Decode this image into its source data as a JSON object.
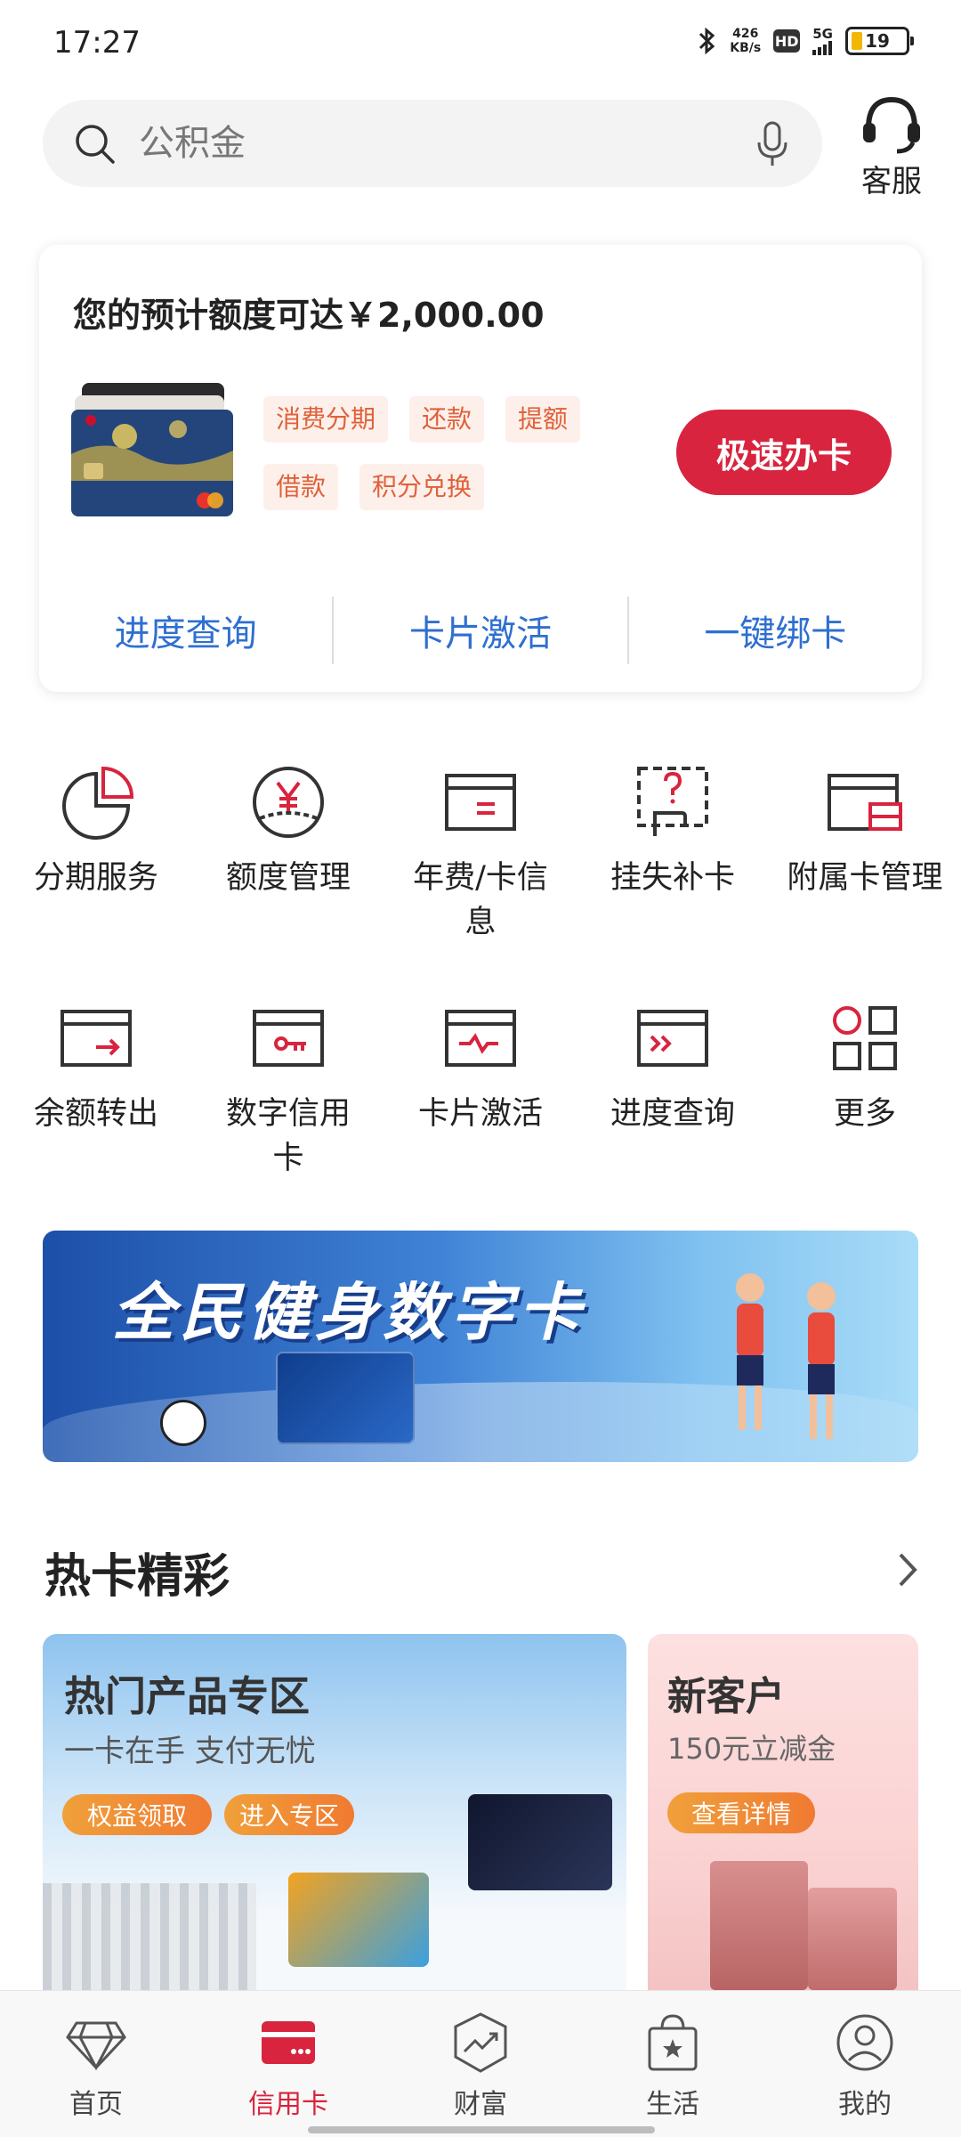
{
  "status": {
    "time": "17:27",
    "net_speed_value": "426",
    "net_speed_unit": "KB/s",
    "hd": "HD",
    "network": "5G",
    "battery": "19"
  },
  "search": {
    "placeholder": "公积金"
  },
  "customer_service": {
    "label": "客服"
  },
  "card_panel": {
    "title": "您的预计额度可达￥2,000.00",
    "tags": [
      "消费分期",
      "还款",
      "提额",
      "借款",
      "积分兑换"
    ],
    "apply_button": "极速办卡",
    "links": [
      "进度查询",
      "卡片激活",
      "一键绑卡"
    ]
  },
  "services": {
    "row1": [
      "分期服务",
      "额度管理",
      "年费/卡信息",
      "挂失补卡",
      "附属卡管理"
    ],
    "row2": [
      "余额转出",
      "数字信用卡",
      "卡片激活",
      "进度查询",
      "更多"
    ]
  },
  "banner": {
    "title": "全民健身数字卡"
  },
  "hot_section": {
    "title": "热卡精彩"
  },
  "promo_main": {
    "title": "热门产品专区",
    "subtitle": "一卡在手 支付无忧",
    "btn1": "权益领取",
    "btn2": "进入专区"
  },
  "promo_new": {
    "title": "新客户",
    "subtitle": "150元立减金",
    "btn": "查看详情"
  },
  "bottom_nav": {
    "items": [
      "首页",
      "信用卡",
      "财富",
      "生活",
      "我的"
    ],
    "active_index": 1
  },
  "colors": {
    "accent": "#d8243e",
    "link": "#2f6fd0",
    "tag_text": "#e0613a",
    "tag_bg": "#fdf0ea"
  }
}
